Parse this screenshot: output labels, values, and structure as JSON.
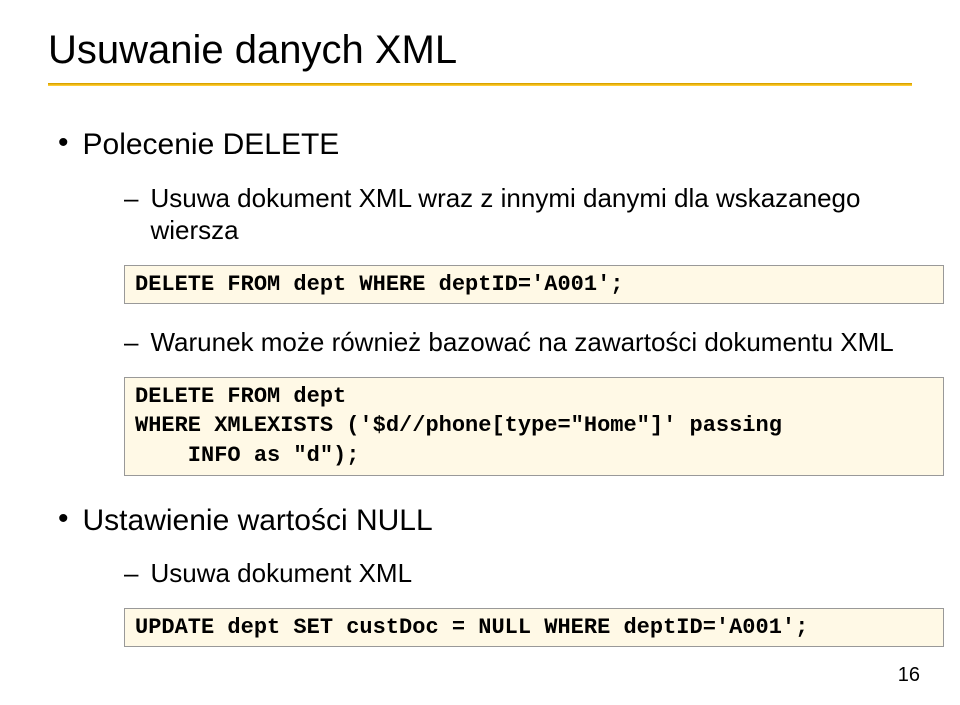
{
  "title": "Usuwanie danych XML",
  "bullets": [
    {
      "text": "Polecenie DELETE",
      "subs": [
        {
          "text": "Usuwa dokument XML wraz z innymi danymi dla wskazanego wiersza",
          "code": "DELETE FROM dept WHERE deptID='A001';"
        },
        {
          "text": "Warunek może również bazować na zawartości dokumentu XML",
          "code": "DELETE FROM dept\nWHERE XMLEXISTS ('$d//phone[type=\"Home\"]' passing\n    INFO as \"d\");"
        }
      ]
    },
    {
      "text": "Ustawienie wartości NULL",
      "subs": [
        {
          "text": "Usuwa dokument XML",
          "code": "UPDATE dept SET custDoc = NULL WHERE deptID='A001';"
        }
      ]
    }
  ],
  "pageNumber": "16"
}
